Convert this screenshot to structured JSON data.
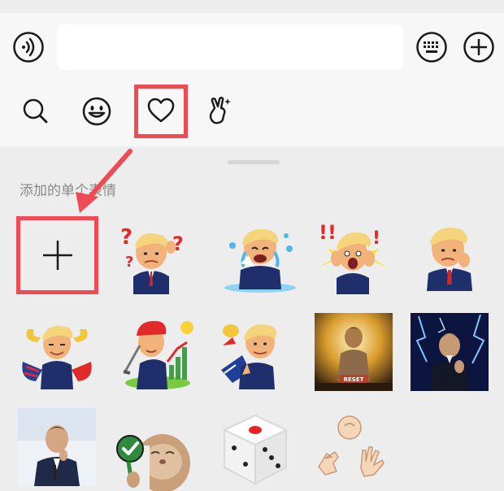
{
  "input_bar": {
    "text_value": "",
    "voice_icon": "voice-icon",
    "keyboard_icon": "keyboard-icon",
    "plus_icon": "plus-icon"
  },
  "tabs": [
    {
      "icon": "search-icon",
      "active": false
    },
    {
      "icon": "emoji-icon",
      "active": false
    },
    {
      "icon": "heart-icon",
      "active": true
    },
    {
      "icon": "hand-sticker-icon",
      "active": false
    }
  ],
  "section_title": "添加的单个表情",
  "stickers": [
    {
      "kind": "add-sticker"
    },
    {
      "kind": "cartoon-man-question"
    },
    {
      "kind": "cartoon-man-crying"
    },
    {
      "kind": "cartoon-man-shocked"
    },
    {
      "kind": "cartoon-man-worried"
    },
    {
      "kind": "cartoon-man-flexing"
    },
    {
      "kind": "cartoon-man-golf"
    },
    {
      "kind": "cartoon-man-pointing"
    },
    {
      "kind": "photo-golden-statue"
    },
    {
      "kind": "photo-lightning-man"
    },
    {
      "kind": "photo-man-speaker"
    },
    {
      "kind": "cat-check"
    },
    {
      "kind": "dice"
    },
    {
      "kind": "rock-paper-scissors-hands"
    }
  ],
  "colors": {
    "highlight": "#ee4b55",
    "background": "#ededed",
    "top_bar": "#f7f7f7"
  }
}
